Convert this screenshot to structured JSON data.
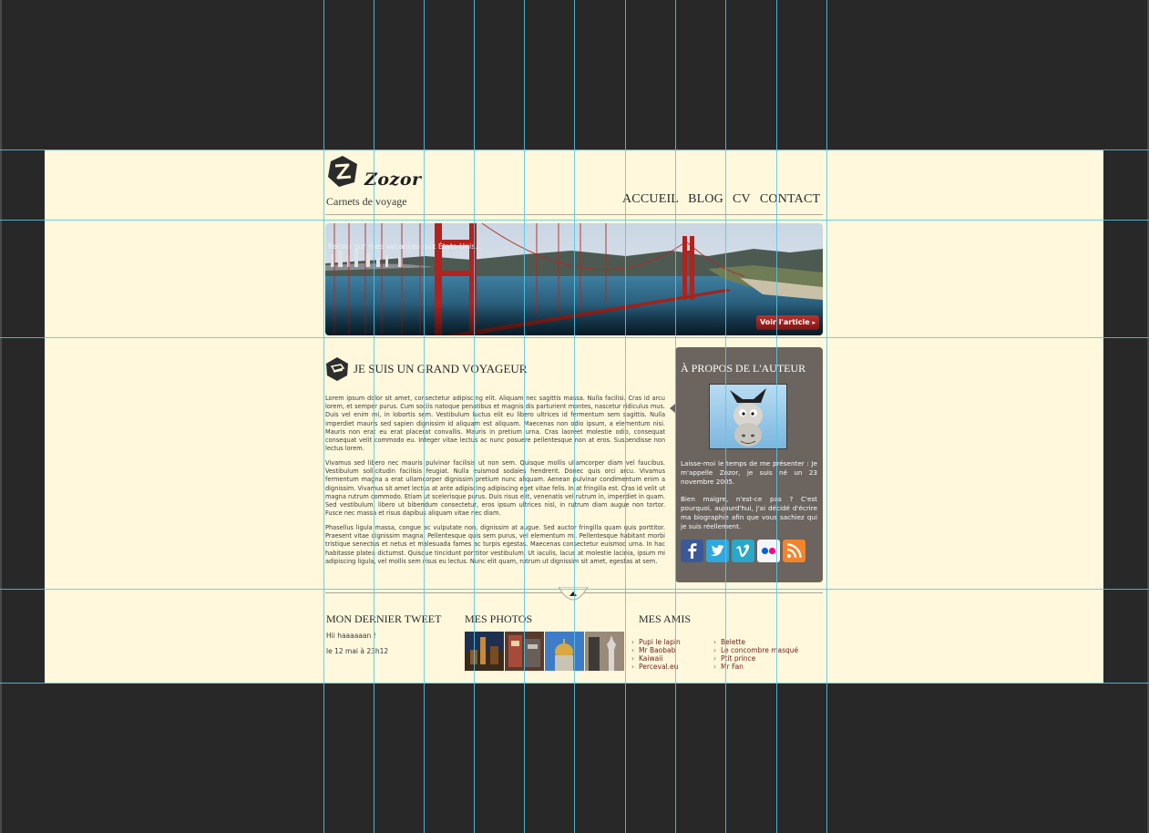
{
  "header": {
    "brand": "Zozor",
    "tagline": "Carnets de voyage",
    "nav": [
      "ACCUEIL",
      "BLOG",
      "CV",
      "CONTACT"
    ]
  },
  "banner": {
    "caption": "Retour sur mes vacances aux États-Unis...",
    "button": "Voir l'article"
  },
  "article": {
    "title": "JE SUIS UN GRAND VOYAGEUR",
    "paragraphs": [
      "Lorem ipsum dolor sit amet, consectetur adipiscing elit. Aliquam nec sagittis massa. Nulla facilisi. Cras id arcu lorem, et semper purus. Cum sociis natoque penatibus et magnis dis parturient montes, nascetur ridiculus mus. Duis vel enim mi, in lobortis sem. Vestibulum luctus elit eu libero ultrices id fermentum sem sagittis. Nulla imperdiet mauris sed sapien dignissim id aliquam est aliquam. Maecenas non odio ipsum, a elementum nisi. Mauris non erat eu erat placerat convallis. Mauris in pretium urna. Cras laoreet molestie odio, consequat consequat velit commodo eu. Integer vitae lectus ac nunc posuere pellentesque non at eros. Suspendisse non lectus lorem.",
      "Vivamus sed libero nec mauris pulvinar facilisis ut non sem. Quisque mollis ullamcorper diam vel faucibus. Vestibulum sollicitudin facilisis feugiat. Nulla euismod sodales hendrerit. Donec quis orci arcu. Vivamus fermentum magna a erat ullamcorper dignissim pretium nunc aliquam. Aenean pulvinar condimentum enim a dignissim. Vivamus sit amet lectus at ante adipiscing adipiscing eget vitae felis. In at fringilla est. Cras id velit ut magna rutrum commodo. Etiam ut scelerisque purus. Duis risus elit, venenatis vel rutrum in, imperdiet in quam. Sed vestibulum, libero ut bibendum consectetur, eros ipsum ultrices nisl, in rutrum diam augue non tortor. Fusce nec massa et risus dapibus aliquam vitae nec diam.",
      "Phasellus ligula massa, congue ac vulputate non, dignissim at augue. Sed auctor fringilla quam quis porttitor. Praesent vitae dignissim magna. Pellentesque quis sem purus, vel elementum mi. Pellentesque habitant morbi tristique senectus et netus et malesuada fames ac turpis egestas. Maecenas consectetur euismod urna. In hac habitasse platea dictumst. Quisque tincidunt porttitor vestibulum. Ut iaculis, lacus at molestie lacinia, ipsum mi adipiscing ligula, vel mollis sem risus eu lectus. Nunc elit quam, rutrum ut dignissim sit amet, egestas at sem."
    ]
  },
  "sidebar": {
    "title": "À PROPOS DE L'AUTEUR",
    "text1": "Laisse-moi le temps de me présenter : Je m'appelle Zozor, je suis né un 23 novembre 2005.",
    "text2": "Bien maigre, n'est-ce pas ? C'est pourquoi, aujourd'hui, j'ai décidé d'écrire ma biographie afin que vous sachiez qui je suis réellement.",
    "social": [
      "facebook-icon",
      "twitter-icon",
      "vimeo-icon",
      "flickr-icon",
      "rss-icon"
    ],
    "social_colors": [
      "#3b5998",
      "#2fa8dd",
      "#2aa7c9",
      "#f5f5f5",
      "#f2842b"
    ]
  },
  "footer": {
    "tweet_title": "MON DERNIER TWEET",
    "tweet_text": "Hii haaaaaan !",
    "tweet_date": "le 12 mai à 23h12",
    "photos_title": "MES PHOTOS",
    "friends_title": "MES AMIS",
    "friends_col1": [
      "Pupi le lapin",
      "Mr Baobab",
      "Kaiwaii",
      "Perceval.eu"
    ],
    "friends_col2": [
      "Belette",
      "Le concombre masqué",
      "Ptit prince",
      "Mr Fan"
    ]
  }
}
